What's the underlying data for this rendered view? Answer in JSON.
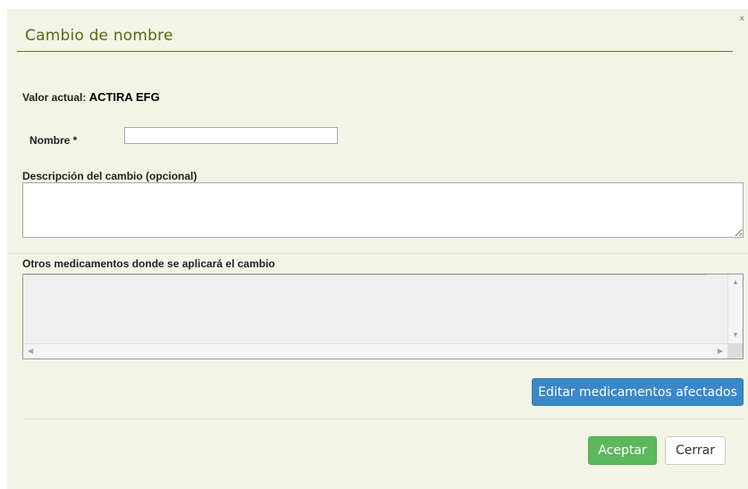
{
  "dialog": {
    "title": "Cambio de nombre",
    "close_glyph": "x"
  },
  "current_value": {
    "label": "Valor actual:",
    "value": "ACTIRA EFG"
  },
  "nombre": {
    "label": "Nombre *",
    "value": ""
  },
  "descripcion": {
    "label": "Descripción del cambio (opcional)",
    "value": ""
  },
  "otros": {
    "label": "Otros medicamentos donde se aplicará el cambio"
  },
  "icons": {
    "scroll_up": "▲",
    "scroll_down": "▼",
    "scroll_left": "◀",
    "scroll_right": "▶"
  },
  "buttons": {
    "edit_label": "Editar medicamentos afectados",
    "accept_label": "Aceptar",
    "close_label": "Cerrar"
  },
  "colors": {
    "dialog_bg": "#f2f4e5",
    "title": "#5e6512",
    "primary": "#3a87c9",
    "success": "#5cb85c"
  }
}
